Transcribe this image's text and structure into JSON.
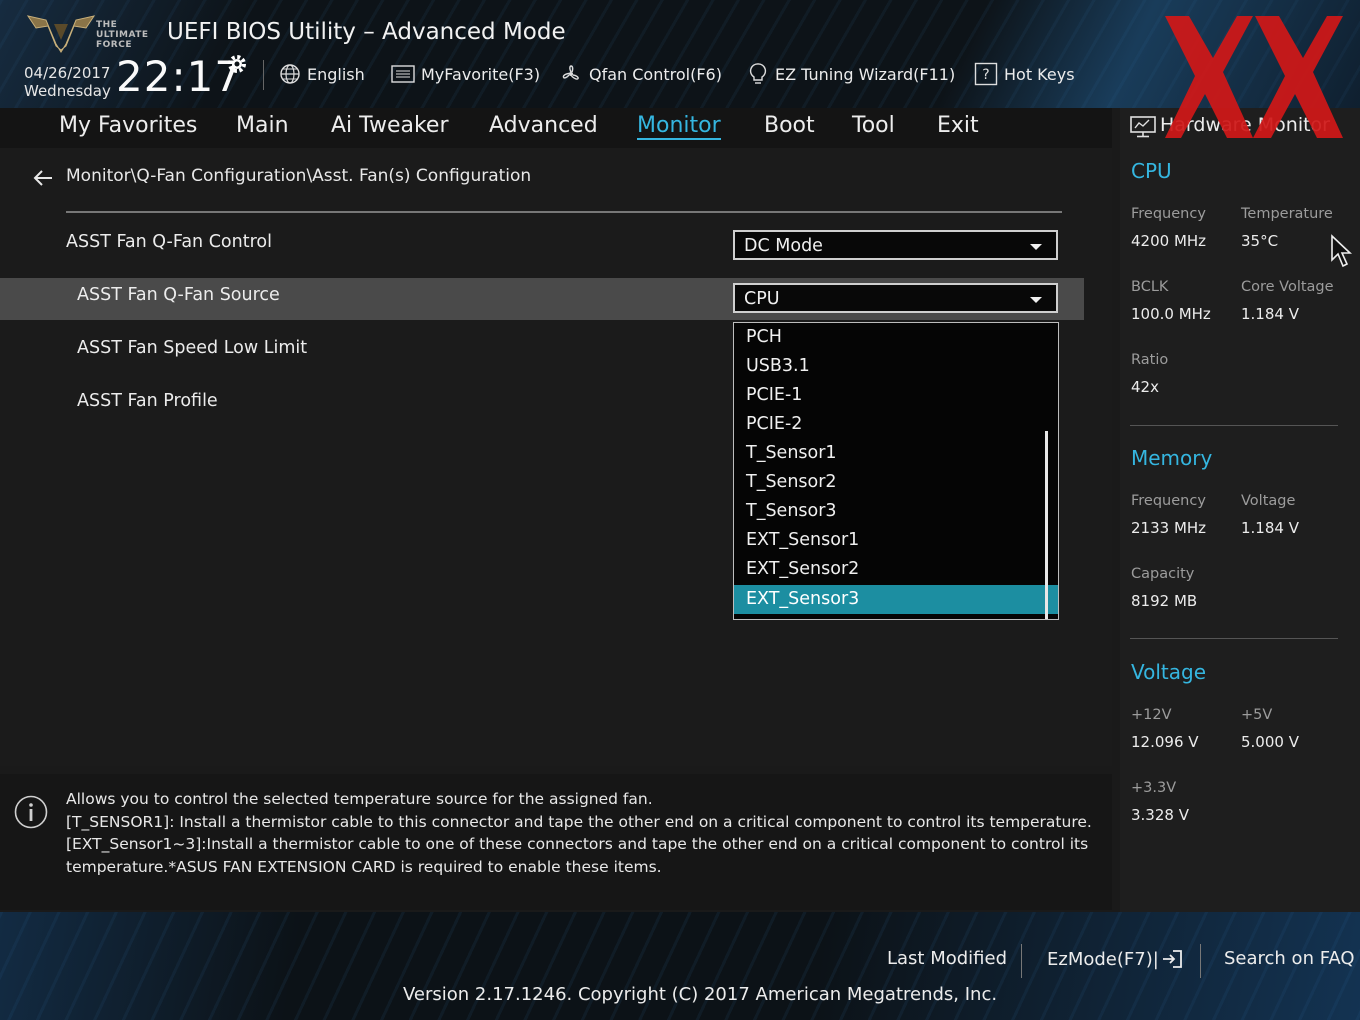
{
  "header": {
    "logo_text": [
      "THE",
      "ULTIMATE",
      "FORCE"
    ],
    "title": "UEFI BIOS Utility – Advanced Mode",
    "date": "04/26/2017",
    "weekday": "Wednesday",
    "time": "22:17",
    "tools": [
      {
        "label": "English",
        "icon": "globe-icon"
      },
      {
        "label": "MyFavorite(F3)",
        "icon": "favorite-list-icon"
      },
      {
        "label": "Qfan Control(F6)",
        "icon": "fan-icon"
      },
      {
        "label": "EZ Tuning Wizard(F11)",
        "icon": "lightbulb-icon"
      },
      {
        "label": "Hot Keys",
        "icon": "help-key-icon"
      }
    ]
  },
  "nav": {
    "tabs": [
      "My Favorites",
      "Main",
      "Ai Tweaker",
      "Advanced",
      "Monitor",
      "Boot",
      "Tool",
      "Exit"
    ],
    "active": "Monitor"
  },
  "main": {
    "breadcrumb": "Monitor\\Q-Fan Configuration\\Asst. Fan(s) Configuration",
    "rows": [
      {
        "label": "ASST Fan Q-Fan Control",
        "value": "DC Mode"
      },
      {
        "label": "ASST Fan Q-Fan Source",
        "value": "CPU"
      },
      {
        "label": "ASST Fan Speed Low Limit"
      },
      {
        "label": "ASST Fan Profile"
      }
    ],
    "dropdown_options": [
      "PCH",
      "USB3.1",
      "PCIE-1",
      "PCIE-2",
      "T_Sensor1",
      "T_Sensor2",
      "T_Sensor3",
      "EXT_Sensor1",
      "EXT_Sensor2",
      "EXT_Sensor3"
    ],
    "dropdown_highlighted": "EXT_Sensor3"
  },
  "help": {
    "lines": [
      "Allows you to control the selected temperature source for the assigned fan.",
      "[T_SENSOR1]: Install a thermistor cable to this connector and tape the other end on a critical component to control its temperature.",
      "[EXT_Sensor1~3]:Install a thermistor cable to one of these connectors and tape the other end on a critical component to control its",
      "temperature.*ASUS FAN EXTENSION CARD is required to enable these items."
    ]
  },
  "hw_monitor": {
    "title": "Hardware Monitor",
    "cpu": {
      "heading": "CPU",
      "frequency_label": "Frequency",
      "frequency": "4200 MHz",
      "temperature_label": "Temperature",
      "temperature": "35°C",
      "bclk_label": "BCLK",
      "bclk": "100.0 MHz",
      "core_voltage_label": "Core Voltage",
      "core_voltage": "1.184 V",
      "ratio_label": "Ratio",
      "ratio": "42x"
    },
    "memory": {
      "heading": "Memory",
      "frequency_label": "Frequency",
      "frequency": "2133 MHz",
      "voltage_label": "Voltage",
      "voltage": "1.184 V",
      "capacity_label": "Capacity",
      "capacity": "8192 MB"
    },
    "voltage": {
      "heading": "Voltage",
      "v12_label": "+12V",
      "v12": "12.096 V",
      "v5_label": "+5V",
      "v5": "5.000 V",
      "v33_label": "+3.3V",
      "v33": "3.328 V"
    }
  },
  "footer": {
    "last_modified": "Last Modified",
    "ezmode": "EzMode(F7)|",
    "search_faq": "Search on FAQ",
    "version": "Version 2.17.1246. Copyright (C) 2017 American Megatrends, Inc."
  },
  "colors": {
    "accent": "#35b6e0",
    "highlight": "#1c8ea1",
    "watermark": "#d01818"
  }
}
